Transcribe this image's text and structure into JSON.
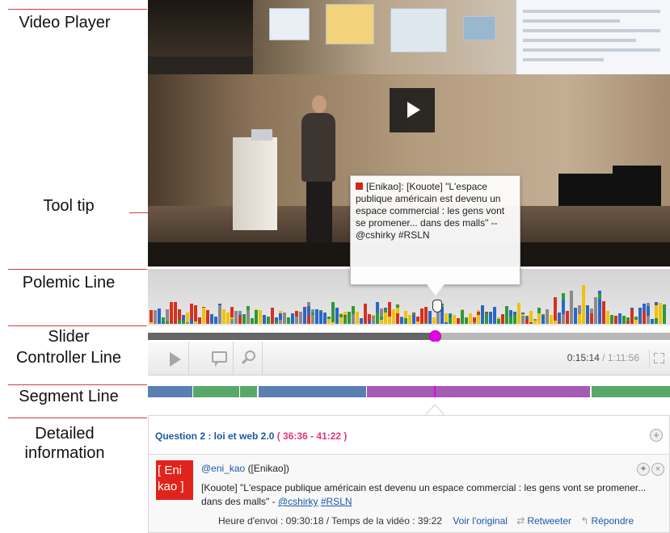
{
  "labels": {
    "video_player": "Video Player",
    "tool_tip": "Tool tip",
    "polemic_line": "Polemic Line",
    "slider": "Slider",
    "controller_line": "Controller Line",
    "segment_line": "Segment Line",
    "detailed_information_1": "Detailed",
    "detailed_information_2": "information"
  },
  "tooltip": {
    "text": "[Enikao]: [Kouote] \"L'espace publique américain est devenu un espace commercial : les gens vont se promener... dans des malls\" -- @cshirky #RSLN",
    "marker_color": "#d0281f"
  },
  "player": {
    "progress": 0.55,
    "current_time": "0:15:14",
    "separator": "/",
    "total_time": "1:11:56"
  },
  "polemic": {
    "colors": [
      "#2e9a34",
      "#f0c20a",
      "#d63020",
      "#2a66c8",
      "#8a8a8a"
    ]
  },
  "segments": [
    {
      "start": 0.0,
      "end": 0.085,
      "color": "#5a7fb0"
    },
    {
      "start": 0.087,
      "end": 0.175,
      "color": "#59a86a"
    },
    {
      "start": 0.177,
      "end": 0.21,
      "color": "#59a86a"
    },
    {
      "start": 0.212,
      "end": 0.418,
      "color": "#5a7fb0"
    },
    {
      "start": 0.42,
      "end": 0.848,
      "color": "#a55ab5"
    },
    {
      "start": 0.85,
      "end": 1.0,
      "color": "#59a86a"
    }
  ],
  "detail": {
    "question_title": "Question 2 : loi et web 2.0",
    "question_range": "( 36:36 - 41:22 )",
    "plus": "+",
    "avatar_text_1": "[ Eni",
    "avatar_text_2": "kao ]",
    "tweet_handle": "@eni_kao",
    "tweet_name": "([Enikao])",
    "tweet_body": "[Kouote] \"L'espace publique américain est devenu un espace commercial : les gens vont se promener... dans des malls\" - ",
    "tweet_mention": "@cshirky",
    "tweet_hashtag": "#RSLN",
    "footer_meta": "Heure d'envoi : 09:30:18 / Temps de la vidéo : 39:22",
    "view_original": "Voir l'original",
    "retweet": "Retweeter",
    "reply": "Répondre",
    "icon_star": "✦",
    "icon_close": "×",
    "icon_retweet": "⇄",
    "icon_reply": "↰"
  }
}
